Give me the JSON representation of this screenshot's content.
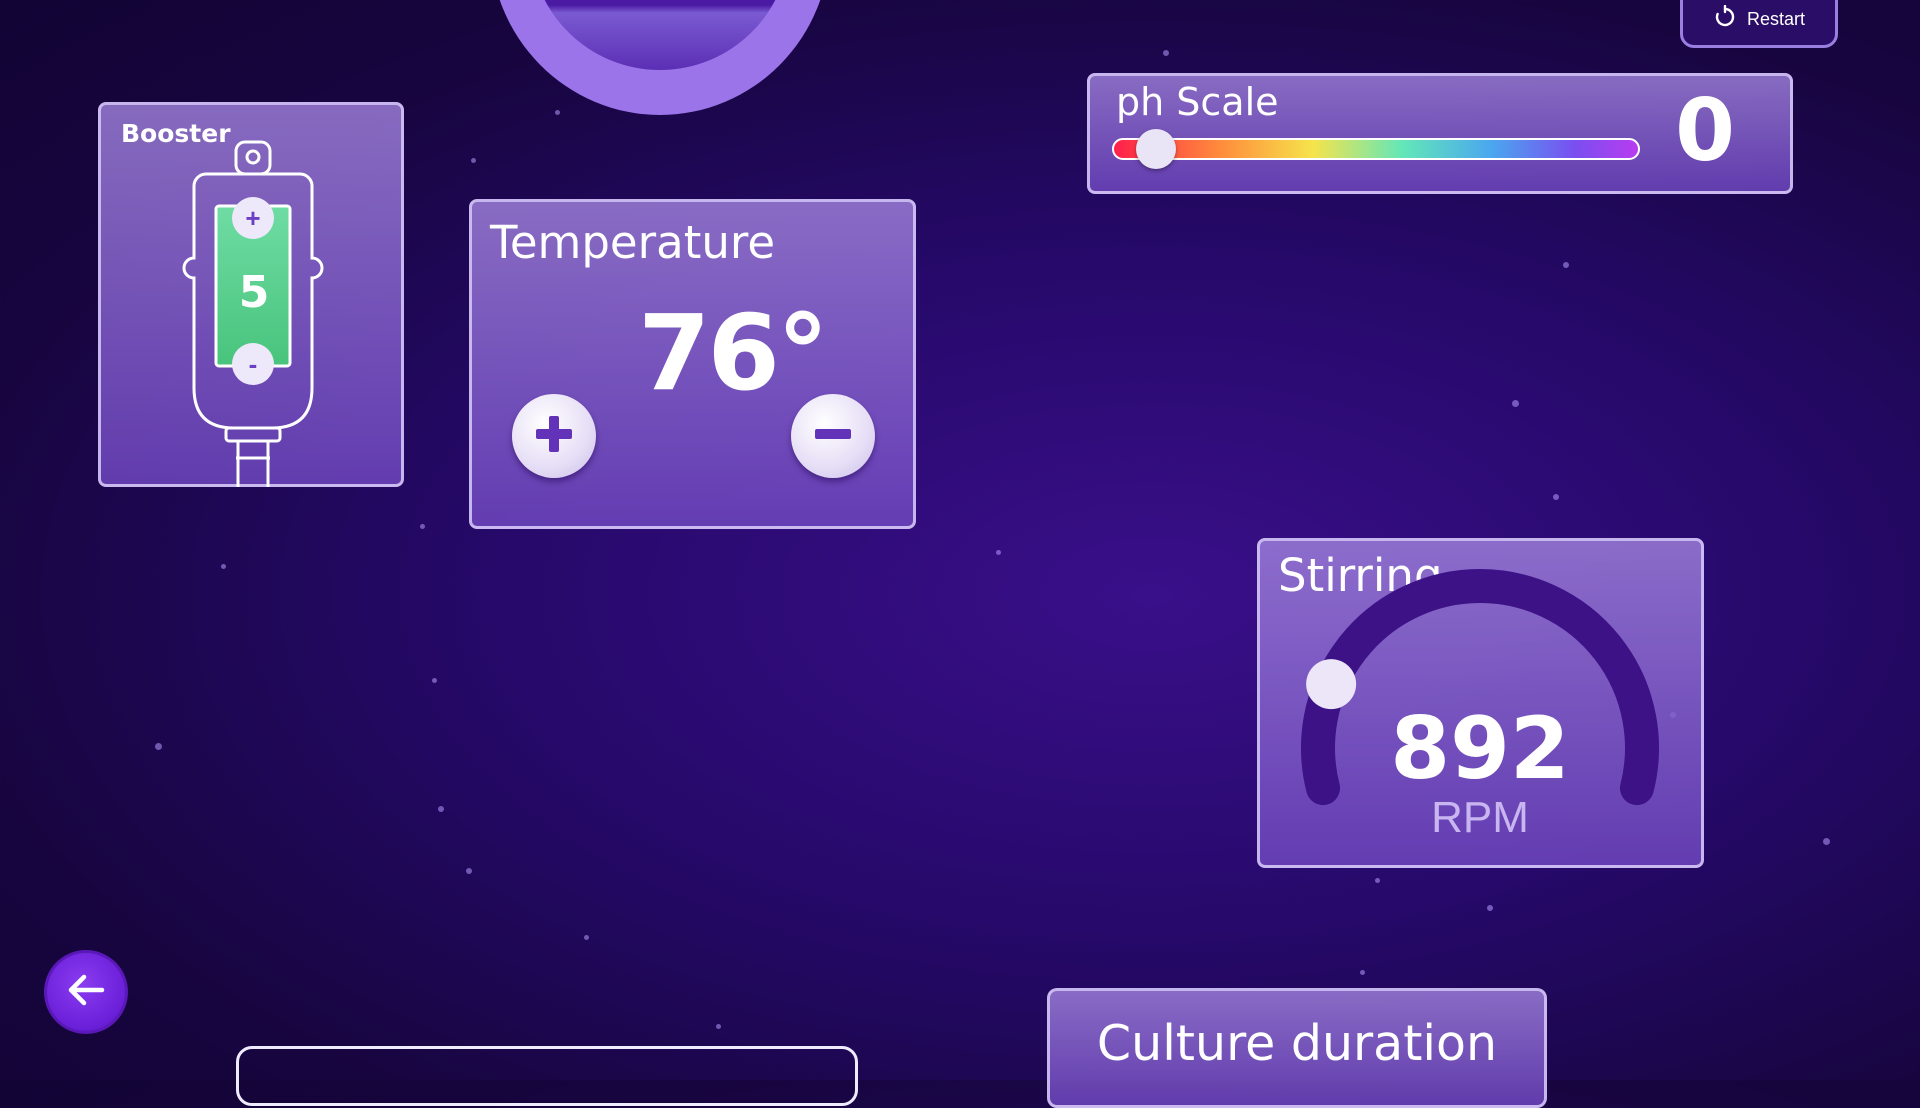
{
  "toolbar": {
    "restart_label": "Restart",
    "restart_icon": "refresh-icon"
  },
  "booster": {
    "title": "Booster",
    "value": "5",
    "plus": "+",
    "minus": "-"
  },
  "temperature": {
    "title": "Temperature",
    "value": "76°",
    "plus_icon": "plus-icon",
    "minus_icon": "minus-icon"
  },
  "ph": {
    "title": "ph Scale",
    "value": "0",
    "slider_fraction": 0.02
  },
  "stirring": {
    "title": "Stirring",
    "value": "892",
    "unit": "RPM",
    "dial_fraction": 0.18
  },
  "culture": {
    "title": "Culture duration"
  },
  "nav": {
    "back_icon": "arrow-left-icon"
  },
  "colors": {
    "accent": "#7a2ff0",
    "panel_border": "#d2c3f5",
    "background": "#1e0753"
  }
}
